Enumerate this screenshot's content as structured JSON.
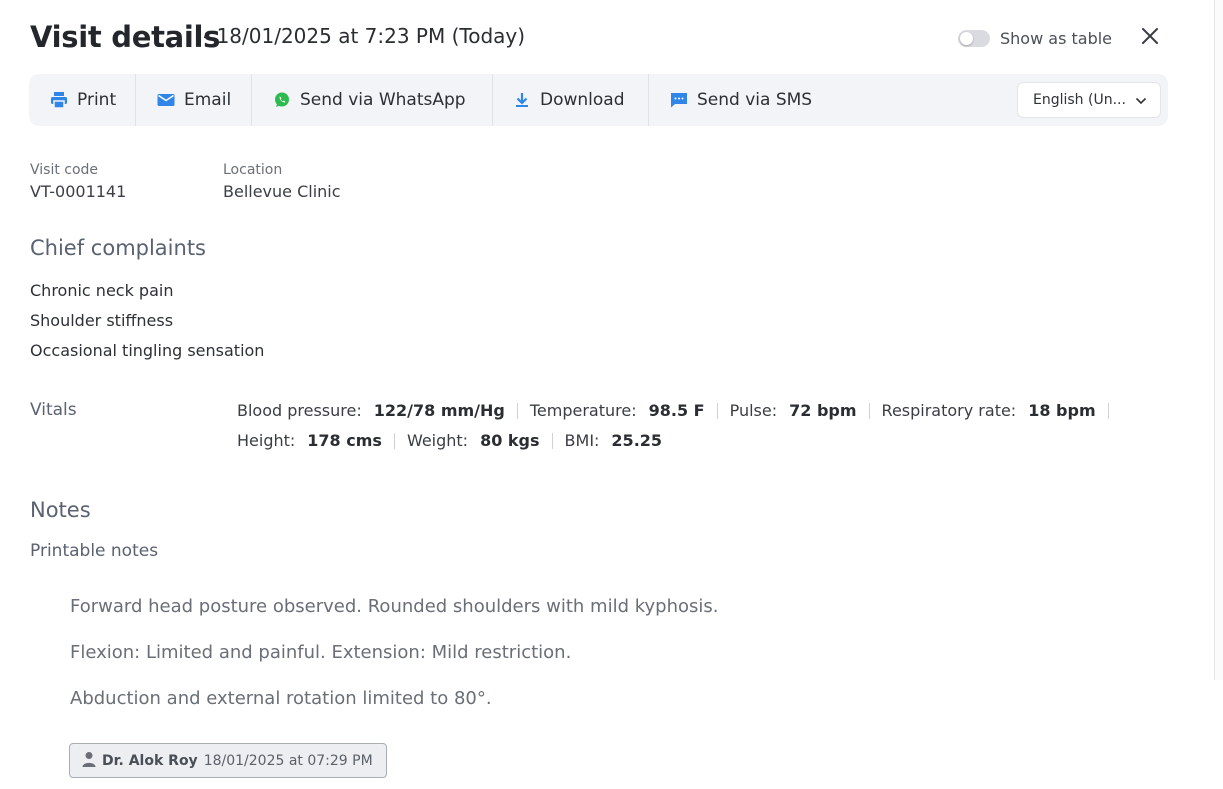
{
  "header": {
    "title": "Visit details",
    "subtitle": "- 18/01/2025 at 7:23 PM (Today)",
    "toggle_label": "Show as table",
    "close_icon": "close-icon"
  },
  "toolbar": {
    "print_label": "Print",
    "email_label": "Email",
    "whatsapp_label": "Send via WhatsApp",
    "download_label": "Download",
    "sms_label": "Send via SMS",
    "language_value": "English (Un...",
    "colors": {
      "icon_blue": "#2f86e8",
      "whatsapp_green": "#2dbb4f",
      "toolbar_bg": "#f3f4f7"
    }
  },
  "visit": {
    "code_label": "Visit code",
    "code_value": "VT-0001141",
    "location_label": "Location",
    "location_value": "Bellevue Clinic"
  },
  "complaints": {
    "title": "Chief complaints",
    "items": [
      "Chronic neck pain",
      "Shoulder stiffness",
      "Occasional tingling sensation"
    ]
  },
  "vitals": {
    "title": "Vitals",
    "bp_label": "Blood pressure:",
    "bp_value": "122/78 mm/Hg",
    "temp_label": "Temperature:",
    "temp_value": "98.5 F",
    "pulse_label": "Pulse:",
    "pulse_value": "72 bpm",
    "resp_label": "Respiratory rate:",
    "resp_value": "18 bpm",
    "height_label": "Height:",
    "height_value": "178 cms",
    "weight_label": "Weight:",
    "weight_value": "80 kgs",
    "bmi_label": "BMI:",
    "bmi_value": "25.25"
  },
  "notes": {
    "title": "Notes",
    "subtitle": "Printable notes",
    "lines": [
      "Forward head posture observed. Rounded shoulders with mild kyphosis.",
      "Flexion: Limited and painful. Extension: Mild restriction.",
      "Abduction and external rotation limited to 80°."
    ],
    "author_name": "Dr. Alok Roy",
    "author_time": "18/01/2025 at 07:29 PM"
  }
}
